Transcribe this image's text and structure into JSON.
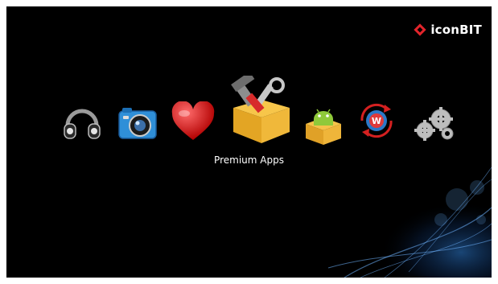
{
  "brand": {
    "name": "iconBIT",
    "accent_color": "#e2242b"
  },
  "menu": {
    "selected_label": "Premium Apps",
    "items": [
      {
        "icon": "headphones-icon"
      },
      {
        "icon": "camera-icon"
      },
      {
        "icon": "heart-icon"
      },
      {
        "icon": "premium-apps-toolbox-icon",
        "selected": true
      },
      {
        "icon": "android-box-icon"
      },
      {
        "icon": "refresh-web-icon"
      },
      {
        "icon": "gears-settings-icon"
      }
    ]
  },
  "colors": {
    "background": "#000000",
    "swirl": "#2f7fd6"
  }
}
